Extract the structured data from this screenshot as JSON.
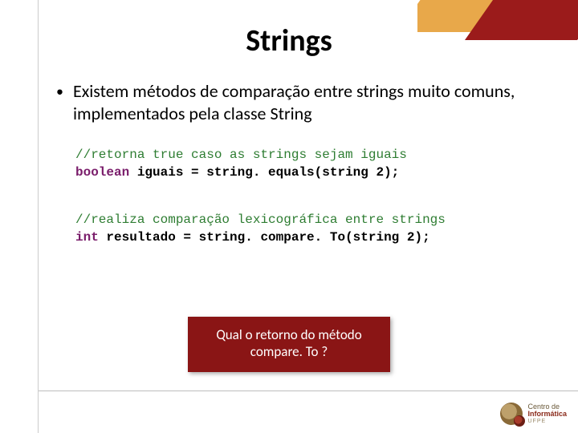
{
  "title": "Strings",
  "bullet": "Existem métodos de comparação entre strings muito comuns, implementados pela classe String",
  "code1": {
    "comment": "//retorna true caso as strings sejam iguais",
    "kw": "boolean",
    "rest": " iguais = string. equals(string 2);"
  },
  "code2": {
    "comment": "//realiza comparação lexicográfica entre strings",
    "kw": "int",
    "rest": " resultado = string. compare. To(string 2);"
  },
  "callout": "Qual o retorno do método compare. To ?",
  "logo": {
    "l1": "Centro de",
    "l2": "Informática",
    "l3": "UFPE"
  }
}
